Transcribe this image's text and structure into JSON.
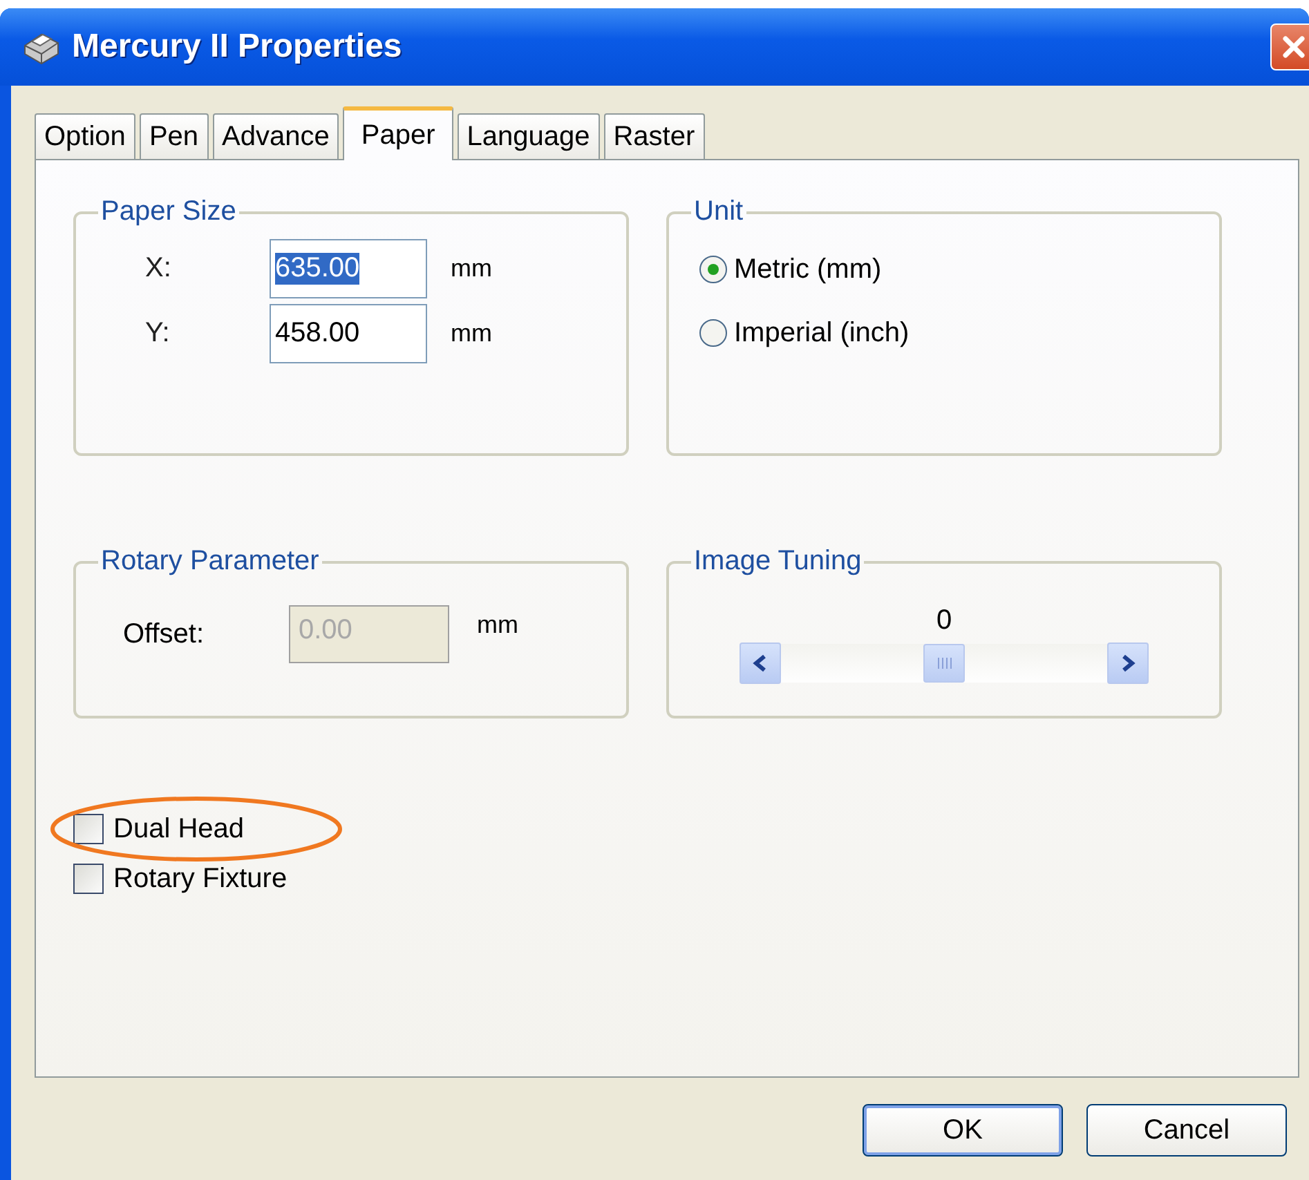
{
  "window": {
    "title": "Mercury II Properties"
  },
  "tabs": [
    {
      "label": "Option",
      "selected": false
    },
    {
      "label": "Pen",
      "selected": false
    },
    {
      "label": "Advance",
      "selected": false
    },
    {
      "label": "Paper",
      "selected": true
    },
    {
      "label": "Language",
      "selected": false
    },
    {
      "label": "Raster",
      "selected": false
    }
  ],
  "paper_size": {
    "title": "Paper Size",
    "fields": [
      {
        "label": "X:",
        "value": "635.00",
        "selected": true,
        "unit": "mm"
      },
      {
        "label": "Y:",
        "value": "458.00",
        "selected": false,
        "unit": "mm"
      }
    ]
  },
  "unit": {
    "title": "Unit",
    "options": [
      {
        "label": "Metric (mm)",
        "selected": true
      },
      {
        "label": "Imperial (inch)",
        "selected": false
      }
    ]
  },
  "rotary_parameter": {
    "title": "Rotary Parameter",
    "label": "Offset:",
    "value": "0.00",
    "disabled": true,
    "unit": "mm"
  },
  "image_tuning": {
    "title": "Image Tuning",
    "reading": "0",
    "level": 0.5
  },
  "checkboxes": [
    {
      "label": "Dual Head",
      "checked": false,
      "highlighted": true
    },
    {
      "label": "Rotary Fixture",
      "checked": false,
      "highlighted": false
    }
  ],
  "buttons": [
    "OK",
    "Cancel"
  ]
}
